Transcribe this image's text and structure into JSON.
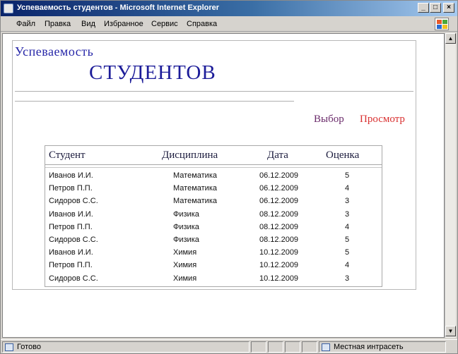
{
  "window": {
    "title": "Успеваемость студентов - Microsoft Internet Explorer",
    "minimize": "_",
    "maximize": "□",
    "close": "×"
  },
  "menu": {
    "items": [
      "Файл",
      "Правка",
      "Вид",
      "Избранное",
      "Сервис",
      "Справка"
    ]
  },
  "page": {
    "heading_small": "Успеваемость",
    "heading_big": "СТУДЕНТОВ",
    "nav": {
      "select_label": "Выбор",
      "view_label": "Просмотр"
    },
    "colors": {
      "heading": "#1c1c99",
      "select_link": "#6a2a6a",
      "view_link": "#d93030"
    }
  },
  "table": {
    "columns": [
      "Студент",
      "Дисциплина",
      "Дата",
      "Оценка"
    ],
    "rows": [
      {
        "student": "Иванов И.И.",
        "subject": "Математика",
        "date": "06.12.2009",
        "grade": "5"
      },
      {
        "student": "Петров П.П.",
        "subject": "Математика",
        "date": "06.12.2009",
        "grade": "4"
      },
      {
        "student": "Сидоров С.С.",
        "subject": "Математика",
        "date": "06.12.2009",
        "grade": "3"
      },
      {
        "student": "Иванов И.И.",
        "subject": "Физика",
        "date": "08.12.2009",
        "grade": "3"
      },
      {
        "student": "Петров П.П.",
        "subject": "Физика",
        "date": "08.12.2009",
        "grade": "4"
      },
      {
        "student": "Сидоров С.С.",
        "subject": "Физика",
        "date": "08.12.2009",
        "grade": "5"
      },
      {
        "student": "Иванов И.И.",
        "subject": "Химия",
        "date": "10.12.2009",
        "grade": "5"
      },
      {
        "student": "Петров П.П.",
        "subject": "Химия",
        "date": "10.12.2009",
        "grade": "4"
      },
      {
        "student": "Сидоров С.С.",
        "subject": "Химия",
        "date": "10.12.2009",
        "grade": "3"
      }
    ]
  },
  "status": {
    "left": "Готово",
    "zone": "Местная интрасеть"
  }
}
